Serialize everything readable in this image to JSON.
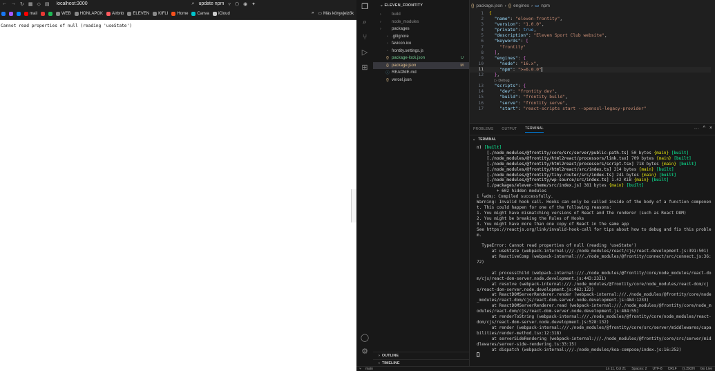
{
  "browser": {
    "url": "localhost:3000",
    "search_tab": "update npm",
    "bookmarks": [
      {
        "label": "",
        "color": "#1877f2"
      },
      {
        "label": "",
        "color": "#a259ff"
      },
      {
        "label": "",
        "color": "#0084ff"
      },
      {
        "label": "mail",
        "color": "#ff0000"
      },
      {
        "label": "",
        "color": "#e53935"
      },
      {
        "label": "",
        "color": "#1db954"
      },
      {
        "label": "WEB",
        "color": "#888888"
      },
      {
        "label": "HONLAPOK",
        "color": "#888888"
      },
      {
        "label": "Airbnb",
        "color": "#ff5a5f"
      },
      {
        "label": "ELEVEN",
        "color": "#888888"
      },
      {
        "label": "KIFLI",
        "color": "#888888"
      },
      {
        "label": "Home",
        "color": "#f4511e"
      },
      {
        "label": "Canva",
        "color": "#00c4cc"
      },
      {
        "label": "iCloud",
        "color": "#cccccc"
      }
    ],
    "more_bookmarks": "»",
    "other_bookmarks": "Más könyvjelzők",
    "error_text": "Cannot read properties of null (reading 'useState')"
  },
  "explorer": {
    "title": "ELEVEN_FRONTITY",
    "items": [
      {
        "label": "build",
        "kind": "folder",
        "dim": true,
        "badge": ""
      },
      {
        "label": "node_modules",
        "kind": "folder",
        "dim": true,
        "badge": ""
      },
      {
        "label": "packages",
        "kind": "folder",
        "dim": false,
        "badge": ""
      },
      {
        "label": ".gitignore",
        "kind": "file",
        "dim": false,
        "badge": ""
      },
      {
        "label": "favicon.ico",
        "kind": "file",
        "dim": false,
        "badge": ""
      },
      {
        "label": "frontity.settings.js",
        "kind": "file",
        "dim": false,
        "badge": ""
      },
      {
        "label": "package-lock.json",
        "kind": "json",
        "dim": false,
        "badge": "U"
      },
      {
        "label": "package.json",
        "kind": "json",
        "dim": false,
        "badge": "M"
      },
      {
        "label": "README.md",
        "kind": "info",
        "dim": false,
        "badge": ""
      },
      {
        "label": "vercel.json",
        "kind": "json",
        "dim": false,
        "badge": ""
      }
    ],
    "outline": "OUTLINE",
    "timeline": "TIMELINE"
  },
  "editor": {
    "breadcrumb": [
      "package.json",
      "engines",
      "npm"
    ],
    "lines": [
      {
        "n": "1",
        "html": "<span class='p1'>{</span>"
      },
      {
        "n": "2",
        "html": "  <span class='k'>\"name\"</span>: <span class='s'>\"eleven-frontity\"</span>,"
      },
      {
        "n": "3",
        "html": "  <span class='k'>\"version\"</span>: <span class='s'>\"1.0.0\"</span>,"
      },
      {
        "n": "4",
        "html": "  <span class='k'>\"private\"</span>: <span class='b'>true</span>,"
      },
      {
        "n": "5",
        "html": "  <span class='k'>\"description\"</span>: <span class='s'>\"Eleven Sport Club website\"</span>,"
      },
      {
        "n": "6",
        "html": "  <span class='k'>\"keywords\"</span>: <span class='p2'>[</span>"
      },
      {
        "n": "7",
        "html": "    <span class='s'>\"frontity\"</span>"
      },
      {
        "n": "8",
        "html": "  <span class='p2'>]</span>,"
      },
      {
        "n": "9",
        "html": "  <span class='k'>\"engines\"</span>: <span class='p2'>{</span>"
      },
      {
        "n": "10",
        "html": "    <span class='k'>\"node\"</span>: <span class='s'>\"16.x\"</span>,"
      },
      {
        "n": "11",
        "html": "    <span class='k'>\"npm\"</span>: <span class='s'>\">=6.0.0\"</span>",
        "cur": true
      },
      {
        "n": "12",
        "html": "  <span class='p2'>}</span>,"
      },
      {
        "n": "",
        "html": "  <span class='lens'>▷ Debug</span>"
      },
      {
        "n": "13",
        "html": "  <span class='k'>\"scripts\"</span>: <span class='p2'>{</span>"
      },
      {
        "n": "14",
        "html": "    <span class='k'>\"dev\"</span>: <span class='s'>\"frontity dev\"</span>,"
      },
      {
        "n": "15",
        "html": "    <span class='k'>\"build\"</span>: <span class='s'>\"frontity build\"</span>,"
      },
      {
        "n": "16",
        "html": "    <span class='k'>\"serve\"</span>: <span class='s'>\"frontity serve\"</span>,"
      },
      {
        "n": "17",
        "html": "    <span class='k'>\"start\"</span>: <span class='s'>\"react-scripts start --openssl-legacy-provider\"</span>"
      }
    ]
  },
  "panel": {
    "tabs": [
      "PROBLEMS",
      "OUTPUT",
      "TERMINAL"
    ],
    "active_tab": "TERMINAL",
    "terminal_label": "TERMINAL",
    "terminal_lines": [
      "<span class='w'>n)</span> <span class='g'>[built]</span>",
      "    <span class='w'>[./node_modules/@frontity/core/src/server/public-path.ts]</span> 50 bytes <span class='y'>{main}</span> <span class='g'>[built]</span>",
      "    <span class='w'>[./node_modules/@frontity/html2react/processors/link.tsx]</span> 709 bytes <span class='y'>{main}</span> <span class='g'>[built]</span>",
      "    <span class='w'>[./node_modules/@frontity/html2react/processors/script.tsx]</span> 718 bytes <span class='y'>{main}</span> <span class='g'>[built]</span>",
      "    <span class='w'>[./node_modules/@frontity/html2react/src/index.ts]</span> 214 bytes <span class='y'>{main}</span> <span class='g'>[built]</span>",
      "    <span class='w'>[./node_modules/@frontity/tiny-router/src/index.ts]</span> 241 bytes <span class='y'>{main}</span> <span class='g'>[built]</span>",
      "    <span class='w'>[./node_modules/@frontity/wp-source/src/index.ts]</span> 1.42 KiB <span class='y'>{main}</span> <span class='g'>[built]</span>",
      "    <span class='w'>[./packages/eleven-theme/src/index.js]</span> 381 bytes <span class='y'>{main}</span> <span class='g'>[built]</span>",
      "        + 602 hidden modules",
      "i ｢wdm｣: Compiled successfully.",
      "Warning: Invalid hook call. Hooks can only be called inside of the body of a function component. This could happen for one of the following reasons:",
      "1. You might have mismatching versions of React and the renderer (such as React DOM)",
      "2. You might be breaking the Rules of Hooks",
      "3. You might have more than one copy of React in the same app",
      "See https://reactjs.org/link/invalid-hook-call for tips about how to debug and fix this problem.",
      "",
      "  TypeError: Cannot read properties of null (reading 'useState')",
      "      at useState (webpack-internal:///./node_modules/react/cjs/react.development.js:391:501)",
      "      at ReactiveComp (webpack-internal:///./node_modules/@frontity/connect/src/connect.js:36:72)",
      "",
      "      at processChild (webpack-internal:///./node_modules/@frontity/core/node_modules/react-dom/cjs/react-dom-server.node.development.js:443:2321)",
      "      at resolve (webpack-internal:///./node_modules/@frontity/core/node_modules/react-dom/cjs/react-dom-server.node.development.js:462:122)",
      "      at ReactDOMServerRenderer.render (webpack-internal:///./node_modules/@frontity/core/node_modules/react-dom/cjs/react-dom-server.node.development.js:484:1233)",
      "      at ReactDOMServerRenderer.read (webpack-internal:///./node_modules/@frontity/core/node_modules/react-dom/cjs/react-dom-server.node.development.js:484:55)",
      "      at renderToString (webpack-internal:///./node_modules/@frontity/core/node_modules/react-dom/cjs/react-dom-server.node.development.js:528:132)",
      "      at render (webpack-internal:///./node_modules/@frontity/core/src/server/middlewares/capabilities/render-method.tsx:12:318)",
      "      at serverSideRendering (webpack-internal:///./node_modules/@frontity/core/src/server/middlewares/server-side-rendering.ts:33:15)",
      "      at dispatch (webpack-internal:///./node_modules/koa-compose/index.js:16:252)"
    ]
  },
  "statusbar": {
    "left": "main",
    "right": [
      "Ln 11, Col 21",
      "Spaces: 2",
      "UTF-8",
      "CRLF",
      "{} JSON",
      "Go Live"
    ]
  }
}
